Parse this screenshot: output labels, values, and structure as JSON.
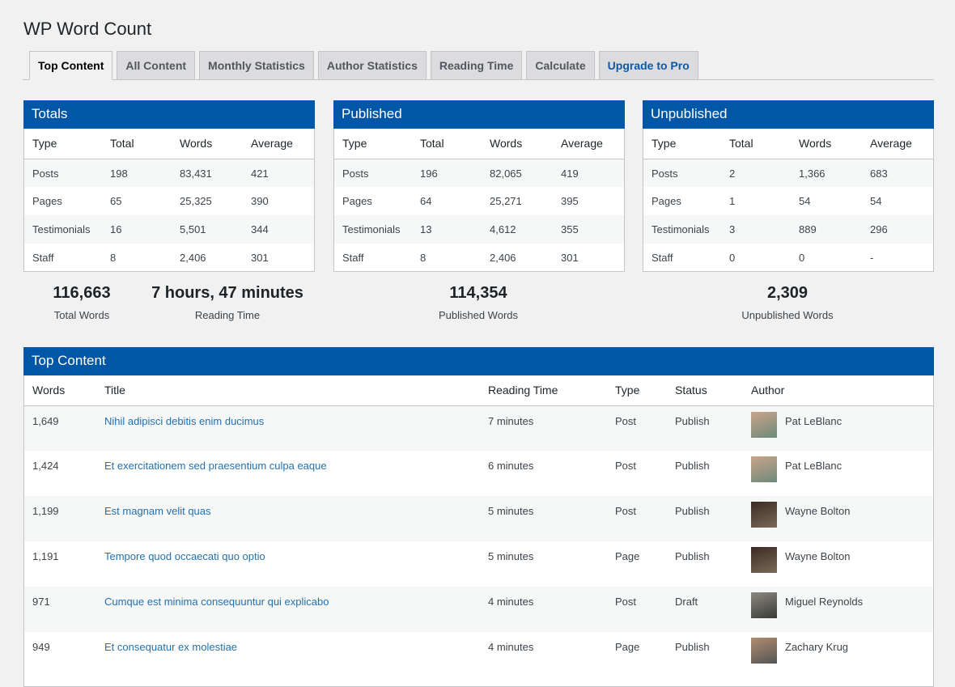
{
  "title": "WP Word Count",
  "tabs": [
    "Top Content",
    "All Content",
    "Monthly Statistics",
    "Author Statistics",
    "Reading Time",
    "Calculate",
    "Upgrade to Pro"
  ],
  "columns": [
    "Type",
    "Total",
    "Words",
    "Average"
  ],
  "boxes": [
    {
      "title": "Totals",
      "rows": [
        [
          "Posts",
          "198",
          "83,431",
          "421"
        ],
        [
          "Pages",
          "65",
          "25,325",
          "390"
        ],
        [
          "Testimonials",
          "16",
          "5,501",
          "344"
        ],
        [
          "Staff",
          "8",
          "2,406",
          "301"
        ]
      ]
    },
    {
      "title": "Published",
      "rows": [
        [
          "Posts",
          "196",
          "82,065",
          "419"
        ],
        [
          "Pages",
          "64",
          "25,271",
          "395"
        ],
        [
          "Testimonials",
          "13",
          "4,612",
          "355"
        ],
        [
          "Staff",
          "8",
          "2,406",
          "301"
        ]
      ]
    },
    {
      "title": "Unpublished",
      "rows": [
        [
          "Posts",
          "2",
          "1,366",
          "683"
        ],
        [
          "Pages",
          "1",
          "54",
          "54"
        ],
        [
          "Testimonials",
          "3",
          "889",
          "296"
        ],
        [
          "Staff",
          "0",
          "0",
          "-"
        ]
      ]
    }
  ],
  "stats": [
    {
      "value": "116,663",
      "label": "Total Words"
    },
    {
      "value": "7 hours, 47 minutes",
      "label": "Reading Time"
    },
    {
      "value": "114,354",
      "label": "Published Words"
    },
    {
      "value": "2,309",
      "label": "Unpublished Words"
    }
  ],
  "top": {
    "title": "Top Content",
    "columns": [
      "Words",
      "Title",
      "Reading Time",
      "Type",
      "Status",
      "Author"
    ],
    "rows": [
      [
        "1,649",
        "Nihil adipisci debitis enim ducimus",
        "7 minutes",
        "Post",
        "Publish",
        "Pat LeBlanc"
      ],
      [
        "1,424",
        "Et exercitationem sed praesentium culpa eaque",
        "6 minutes",
        "Post",
        "Publish",
        "Pat LeBlanc"
      ],
      [
        "1,199",
        "Est magnam velit quas",
        "5 minutes",
        "Post",
        "Publish",
        "Wayne Bolton"
      ],
      [
        "1,191",
        "Tempore quod occaecati quo optio",
        "5 minutes",
        "Page",
        "Publish",
        "Wayne Bolton"
      ],
      [
        "971",
        "Cumque est minima consequuntur qui explicabo",
        "4 minutes",
        "Post",
        "Draft",
        "Miguel Reynolds"
      ],
      [
        "949",
        "Et consequatur ex molestiae",
        "4 minutes",
        "Page",
        "Publish",
        "Zachary Krug"
      ]
    ]
  }
}
